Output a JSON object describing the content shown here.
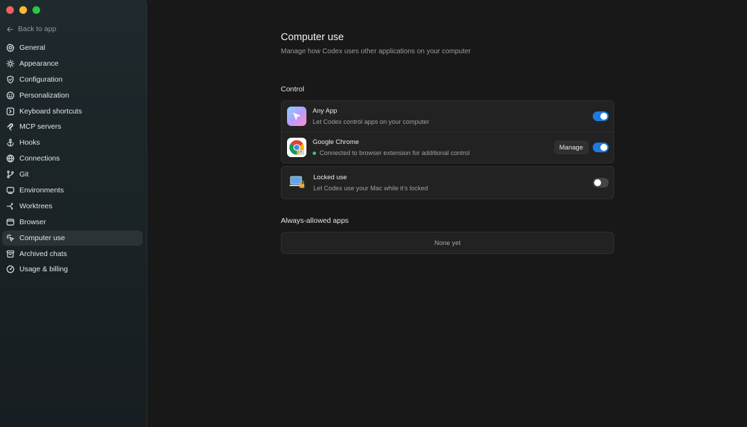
{
  "sidebar": {
    "back_label": "Back to app",
    "items": [
      {
        "label": "General",
        "icon": "gear-icon"
      },
      {
        "label": "Appearance",
        "icon": "sun-icon"
      },
      {
        "label": "Configuration",
        "icon": "shield-icon"
      },
      {
        "label": "Personalization",
        "icon": "smile-icon"
      },
      {
        "label": "Keyboard shortcuts",
        "icon": "keyboard-icon"
      },
      {
        "label": "MCP servers",
        "icon": "mcp-icon"
      },
      {
        "label": "Hooks",
        "icon": "anchor-icon"
      },
      {
        "label": "Connections",
        "icon": "globe-icon"
      },
      {
        "label": "Git",
        "icon": "git-branch-icon"
      },
      {
        "label": "Environments",
        "icon": "monitor-icon"
      },
      {
        "label": "Worktrees",
        "icon": "worktree-icon"
      },
      {
        "label": "Browser",
        "icon": "browser-icon"
      },
      {
        "label": "Computer use",
        "icon": "cursor-click-icon",
        "active": true
      },
      {
        "label": "Archived chats",
        "icon": "archive-icon"
      },
      {
        "label": "Usage & billing",
        "icon": "gauge-icon"
      }
    ]
  },
  "page": {
    "title": "Computer use",
    "subtitle": "Manage how Codex uses other applications on your computer"
  },
  "control": {
    "section_title": "Control",
    "any_app": {
      "title": "Any App",
      "description": "Let Codex control apps on your computer",
      "enabled": true
    },
    "chrome": {
      "title": "Google Chrome",
      "description": "Connected to browser extension for additional control",
      "manage_label": "Manage",
      "status_color": "#3cc36b",
      "enabled": true
    },
    "locked": {
      "title": "Locked use",
      "description": "Let Codex use your Mac while it's locked",
      "enabled": false
    }
  },
  "always_allowed": {
    "section_title": "Always-allowed apps",
    "empty_label": "None yet"
  },
  "colors": {
    "accent": "#1f7ae0",
    "traffic_red": "#fe5f57",
    "traffic_yellow": "#febc2e",
    "traffic_green": "#28c840"
  }
}
